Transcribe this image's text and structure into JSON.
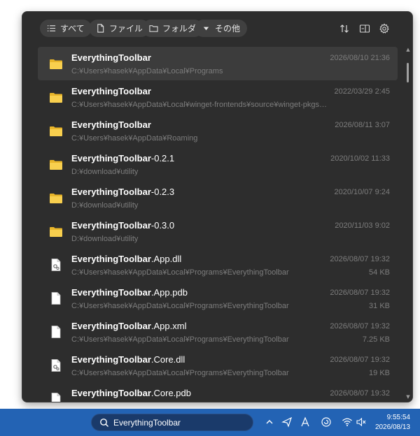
{
  "filters": [
    {
      "label": "すべて",
      "icon": "list-icon"
    },
    {
      "label": "ファイル",
      "icon": "file-icon"
    },
    {
      "label": "フォルダ",
      "icon": "folder-outline-icon"
    },
    {
      "label": "その他",
      "icon": "caret-down-icon"
    }
  ],
  "toolbar_icons": [
    "sort-icon",
    "preview-pane-icon",
    "gear-icon"
  ],
  "results": [
    {
      "bold": "EverythingToolbar",
      "rest": "",
      "path": "C:¥Users¥hasek¥AppData¥Local¥Programs",
      "date": "2026/08/10 21:36",
      "size": "",
      "icon": "folder-icon"
    },
    {
      "bold": "EverythingToolbar",
      "rest": "",
      "path": "C:¥Users¥hasek¥AppData¥Local¥winget-frontends¥source¥winget-pkgs¥pk...",
      "date": "2022/03/29 2:45",
      "size": "",
      "icon": "folder-icon"
    },
    {
      "bold": "EverythingToolbar",
      "rest": "",
      "path": "C:¥Users¥hasek¥AppData¥Roaming",
      "date": "2026/08/11 3:07",
      "size": "",
      "icon": "folder-icon"
    },
    {
      "bold": "EverythingToolbar",
      "rest": "-0.2.1",
      "path": "D:¥download¥utility",
      "date": "2020/10/02 11:33",
      "size": "",
      "icon": "folder-icon"
    },
    {
      "bold": "EverythingToolbar",
      "rest": "-0.2.3",
      "path": "D:¥download¥utility",
      "date": "2020/10/07 9:24",
      "size": "",
      "icon": "folder-icon"
    },
    {
      "bold": "EverythingToolbar",
      "rest": "-0.3.0",
      "path": "D:¥download¥utility",
      "date": "2020/11/03 9:02",
      "size": "",
      "icon": "folder-icon"
    },
    {
      "bold": "EverythingToolbar",
      "rest": ".App.dll",
      "path": "C:¥Users¥hasek¥AppData¥Local¥Programs¥EverythingToolbar",
      "date": "2026/08/07 19:32",
      "size": "54 KB",
      "icon": "dll-file-icon"
    },
    {
      "bold": "EverythingToolbar",
      "rest": ".App.pdb",
      "path": "C:¥Users¥hasek¥AppData¥Local¥Programs¥EverythingToolbar",
      "date": "2026/08/07 19:32",
      "size": "31 KB",
      "icon": "file-icon"
    },
    {
      "bold": "EverythingToolbar",
      "rest": ".App.xml",
      "path": "C:¥Users¥hasek¥AppData¥Local¥Programs¥EverythingToolbar",
      "date": "2026/08/07 19:32",
      "size": "7.25 KB",
      "icon": "file-icon"
    },
    {
      "bold": "EverythingToolbar",
      "rest": ".Core.dll",
      "path": "C:¥Users¥hasek¥AppData¥Local¥Programs¥EverythingToolbar",
      "date": "2026/08/07 19:32",
      "size": "19 KB",
      "icon": "dll-file-icon"
    },
    {
      "bold": "EverythingToolbar",
      "rest": ".Core.pdb",
      "path": "",
      "date": "2026/08/07 19:32",
      "size": "",
      "icon": "file-icon"
    }
  ],
  "taskbar": {
    "search_text": "EverythingToolbar",
    "clock_time": "9:55:54",
    "clock_date": "2026/08/13",
    "tray_icons": [
      "chevron-up-icon",
      "send-icon",
      "ime-a-icon",
      "refresh-circle-icon",
      "wifi-icon",
      "speaker-muted-icon"
    ]
  },
  "colors": {
    "popup_bg": "#2d2d2d",
    "selected_row": "#3c3c3c",
    "taskbar": "#2363b4",
    "folder": "#f5c842"
  }
}
